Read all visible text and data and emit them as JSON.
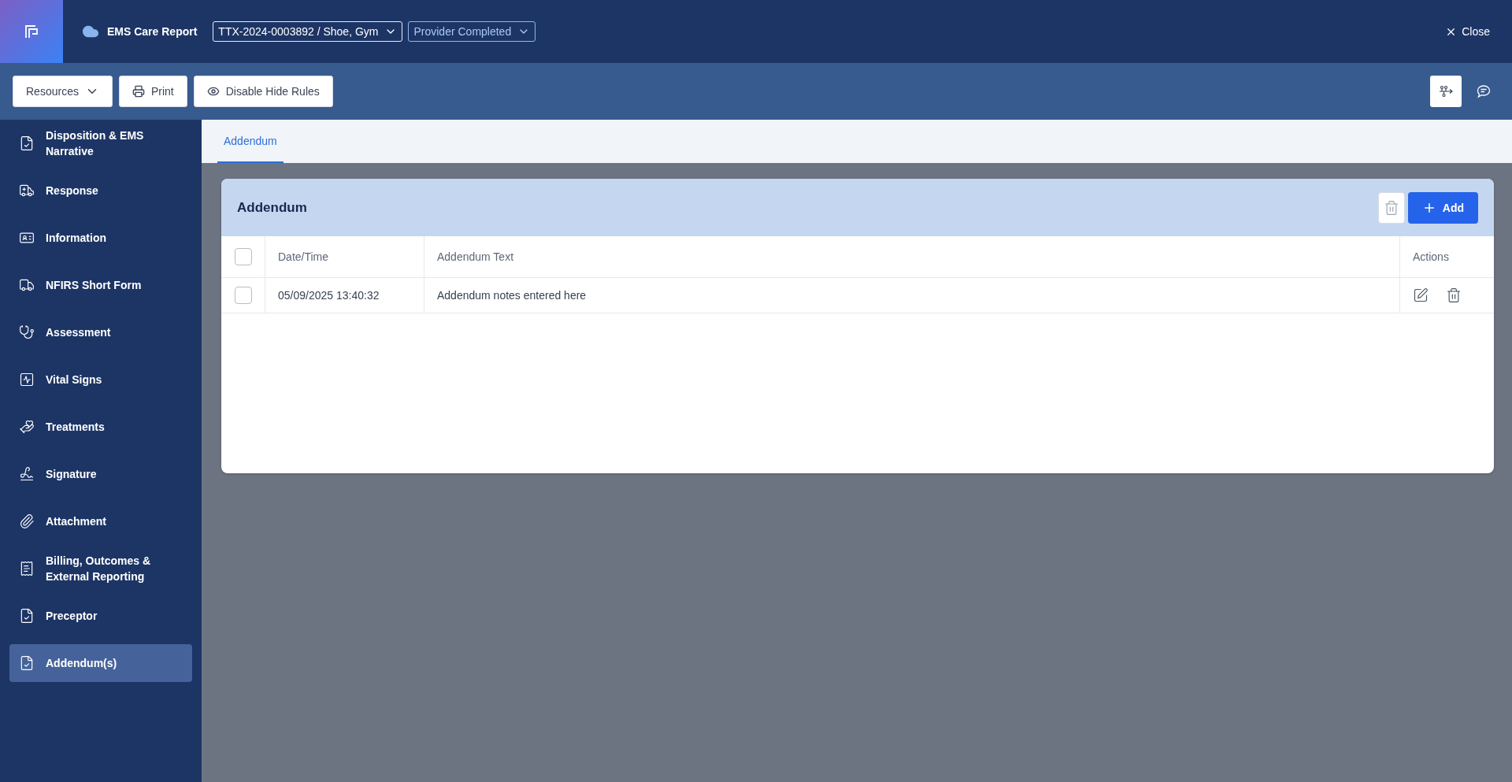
{
  "header": {
    "title": "EMS Care Report",
    "record_select": "TTX-2024-0003892 / Shoe, Gym",
    "status_select": "Provider Completed",
    "close": "Close"
  },
  "toolbar": {
    "buttons": [
      {
        "label": "Resources",
        "kind": "dropdown"
      },
      {
        "label": "Print",
        "kind": "print"
      },
      {
        "label": "Disable Hide Rules",
        "kind": "eye"
      }
    ]
  },
  "sidebar": {
    "items": [
      {
        "label": "Disposition & EMS Narrative",
        "selected": false
      },
      {
        "label": "Response",
        "selected": false
      },
      {
        "label": "Information",
        "selected": false
      },
      {
        "label": "NFIRS Short Form",
        "selected": false
      },
      {
        "label": "Assessment",
        "selected": false
      },
      {
        "label": "Vital Signs",
        "selected": false
      },
      {
        "label": "Treatments",
        "selected": false
      },
      {
        "label": "Signature",
        "selected": false
      },
      {
        "label": "Attachment",
        "selected": false
      },
      {
        "label": "Billing, Outcomes & External Reporting",
        "selected": false
      },
      {
        "label": "Preceptor",
        "selected": false
      },
      {
        "label": "Addendum(s)",
        "selected": true
      }
    ]
  },
  "tabs": [
    {
      "label": "Addendum",
      "selected": true
    }
  ],
  "panel": {
    "title": "Addendum",
    "add_button": "Add",
    "select_all_checked": false,
    "table": {
      "columns": [
        "Date/Time",
        "Addendum Text",
        "Actions"
      ],
      "rows": [
        {
          "checked": false,
          "date_time": "05/09/2025 13:40:32",
          "text": "Addendum notes entered here"
        }
      ]
    }
  }
}
